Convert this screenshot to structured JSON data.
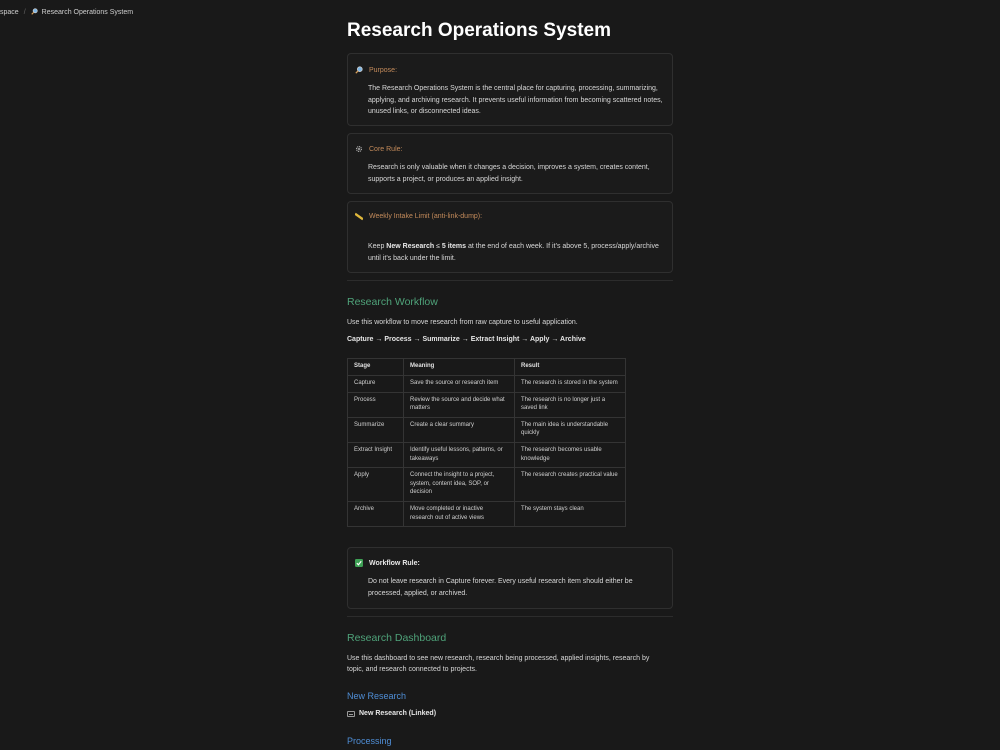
{
  "breadcrumb": {
    "workspace": "space",
    "separator": "/",
    "page_icon": "magnifier-icon",
    "page": "Research Operations System"
  },
  "title": "Research Operations System",
  "callouts": {
    "purpose": {
      "icon": "magnifier-icon",
      "label": "Purpose:",
      "body": "The Research Operations System is the central place for capturing, processing, summarizing, applying, and archiving research. It prevents useful information from becoming scattered notes, unused links, or disconnected ideas."
    },
    "core_rule": {
      "icon": "gear-icon",
      "label": "Core Rule:",
      "body": "Research is only valuable when it changes a decision, improves a system, creates content, supports a project, or produces an applied insight."
    },
    "intake": {
      "icon": "ruler-icon",
      "label": "Weekly Intake Limit (anti-link-dump):",
      "body_pre": "Keep ",
      "body_bold1": "New Research",
      "body_mid": " ≤ ",
      "body_bold2": "5 items",
      "body_post": " at the end of each week. If it’s above 5, process/apply/archive until it’s back under the limit."
    },
    "workflow_rule": {
      "icon": "check-icon",
      "label": "Workflow Rule:",
      "body": "Do not leave research in Capture forever. Every useful research item should either be processed, applied, or archived."
    }
  },
  "workflow": {
    "heading": "Research Workflow",
    "intro": "Use this workflow to move research from raw capture to useful application.",
    "flow": "Capture → Process → Summarize → Extract Insight → Apply → Archive",
    "table": {
      "headers": [
        "Stage",
        "Meaning",
        "Result"
      ],
      "rows": [
        [
          "Capture",
          "Save the source or research item",
          "The research is stored in the system"
        ],
        [
          "Process",
          "Review the source and decide what matters",
          "The research is no longer just a saved link"
        ],
        [
          "Summarize",
          "Create a clear summary",
          "The main idea is understandable quickly"
        ],
        [
          "Extract Insight",
          "Identify useful lessons, patterns, or takeaways",
          "The research becomes usable knowledge"
        ],
        [
          "Apply",
          "Connect the insight to a project, system, content idea, SOP, or decision",
          "The research creates practical value"
        ],
        [
          "Archive",
          "Move completed or inactive research out of active views",
          "The system stays clean"
        ]
      ]
    }
  },
  "dashboard": {
    "heading": "Research Dashboard",
    "intro": "Use this dashboard to see new research, research being processed, applied insights, research by topic, and research connected to projects.",
    "new_research_heading": "New Research",
    "new_research_link": "New Research (Linked)",
    "processing_heading": "Processing"
  },
  "colors": {
    "background": "#191919",
    "heading_green": "#4fa37a",
    "heading_blue": "#4f8ed6",
    "callout_label": "#c48b5b",
    "check_green": "#3ea055"
  }
}
